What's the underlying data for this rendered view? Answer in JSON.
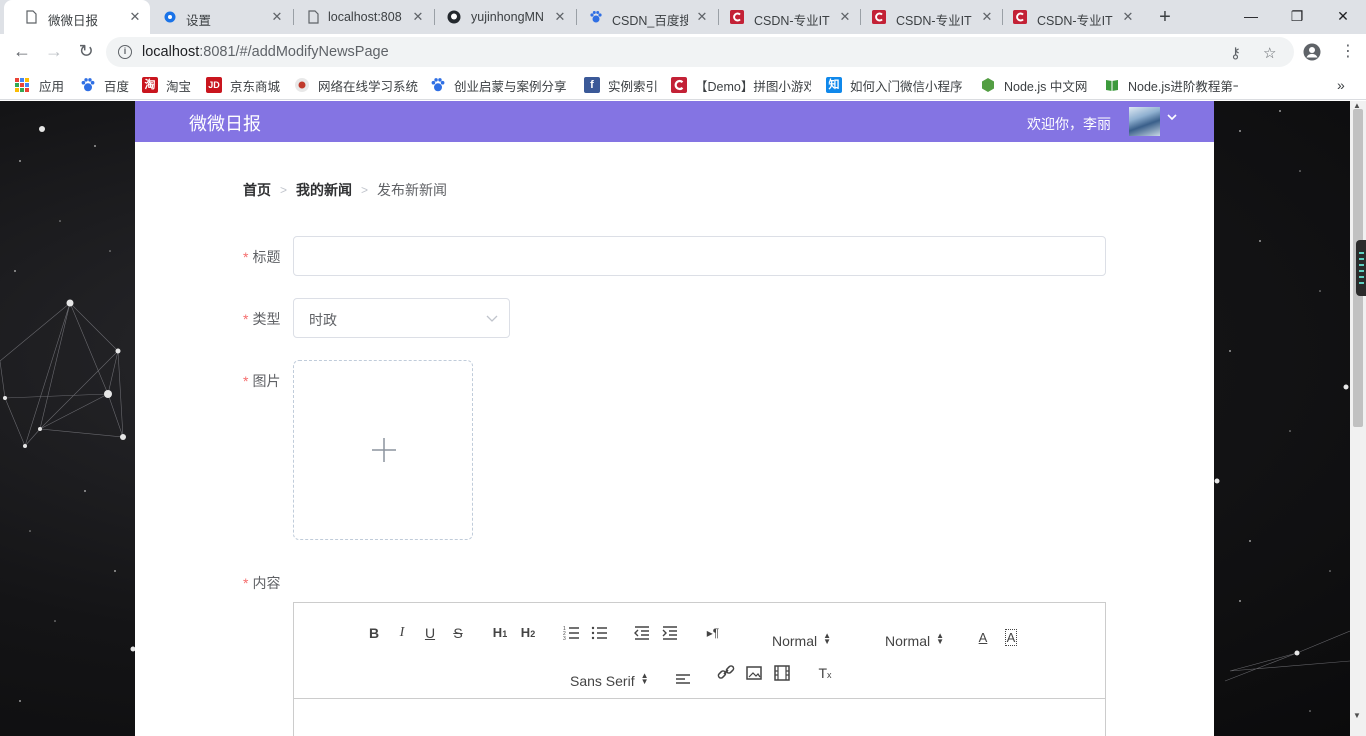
{
  "browser": {
    "tabs": [
      {
        "title": "微微日报",
        "active": true,
        "icon": "page-icon"
      },
      {
        "title": "设置",
        "active": false,
        "icon": "gear-icon"
      },
      {
        "title": "localhost:808",
        "active": false,
        "icon": "page-icon"
      },
      {
        "title": "yujinhongMN",
        "active": false,
        "icon": "github-icon"
      },
      {
        "title": "CSDN_百度搜",
        "active": false,
        "icon": "baidu-paw-icon"
      },
      {
        "title": "CSDN-专业IT",
        "active": false,
        "icon": "csdn-icon"
      },
      {
        "title": "CSDN-专业IT",
        "active": false,
        "icon": "csdn-icon"
      },
      {
        "title": "CSDN-专业IT",
        "active": false,
        "icon": "csdn-icon"
      }
    ],
    "url_host": "localhost",
    "url_rest": ":8081/#/addModifyNewsPage",
    "bookmarks": [
      {
        "label": "应用",
        "icon": "apps-grid-icon"
      },
      {
        "label": "百度",
        "icon": "baidu-paw-icon"
      },
      {
        "label": "淘宝",
        "icon": "taobao-icon"
      },
      {
        "label": "京东商城",
        "icon": "jd-icon"
      },
      {
        "label": "网络在线学习系统",
        "icon": "circle-logo-icon"
      },
      {
        "label": "创业启蒙与案例分享",
        "icon": "baidu-paw-icon"
      },
      {
        "label": "实例索引",
        "icon": "facebook-icon"
      },
      {
        "label": "【Demo】拼图小游戏",
        "icon": "csdn-icon"
      },
      {
        "label": "如何入门微信小程序",
        "icon": "zhihu-icon"
      },
      {
        "label": "Node.js 中文网",
        "icon": "nodejs-icon"
      },
      {
        "label": "Node.js进阶教程第一",
        "icon": "book-icon"
      }
    ]
  },
  "app": {
    "brand": "微微日报",
    "welcome": "欢迎你，李丽",
    "header_color": "#8474e3"
  },
  "breadcrumb": {
    "home": "首页",
    "my_news": "我的新闻",
    "current": "发布新新闻"
  },
  "form": {
    "title_label": "标题",
    "title_value": "",
    "type_label": "类型",
    "type_value": "时政",
    "image_label": "图片",
    "content_label": "内容",
    "required_mark": "*"
  },
  "editor": {
    "size_picker": "Normal",
    "header_picker": "Normal",
    "font_picker": "Sans Serif"
  }
}
